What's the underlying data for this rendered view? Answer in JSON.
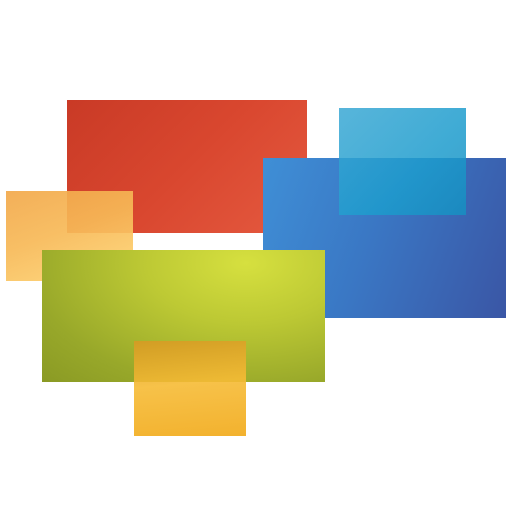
{
  "artwork": {
    "tiles": [
      {
        "name": "red-tile",
        "color": "#d9472f"
      },
      {
        "name": "orange-left-tile",
        "color": "#f7b957"
      },
      {
        "name": "blue-tile",
        "color": "#3a77c4"
      },
      {
        "name": "cyan-tile",
        "color": "#1d9ccd"
      },
      {
        "name": "green-tile",
        "color": "#bdc934"
      },
      {
        "name": "orange-bottom-tile",
        "color": "#f6bb35"
      }
    ]
  }
}
